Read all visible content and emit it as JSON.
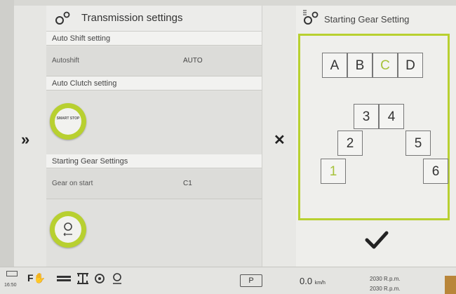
{
  "left_panel": {
    "title": "Transmission settings",
    "sections": {
      "auto_shift": {
        "header": "Auto Shift setting",
        "key": "Autoshift",
        "value": "AUTO"
      },
      "auto_clutch": {
        "header": "Auto Clutch setting",
        "button_text": "SMART STOP"
      },
      "starting_gear": {
        "header": "Starting Gear Settings",
        "key": "Gear on start",
        "value": "C1"
      }
    }
  },
  "right_panel": {
    "title": "Starting Gear Setting",
    "ranges": [
      "A",
      "B",
      "C",
      "D"
    ],
    "selected_range": "C",
    "gears": [
      "1",
      "2",
      "3",
      "4",
      "5",
      "6"
    ],
    "selected_gear": "1"
  },
  "status_bar": {
    "time": "16:50",
    "parking": "P",
    "speed": "0.0",
    "speed_unit": "km/h",
    "rpm_line1": "2030 R.p.m.",
    "rpm_line2": "2030 R.p.m."
  },
  "icons": {
    "expand": "double-chevron-right-icon",
    "close": "close-icon",
    "confirm": "checkmark-icon",
    "settings": "gears-icon"
  },
  "colors": {
    "accent": "#b8d030",
    "selected_text": "#a6c23a"
  }
}
